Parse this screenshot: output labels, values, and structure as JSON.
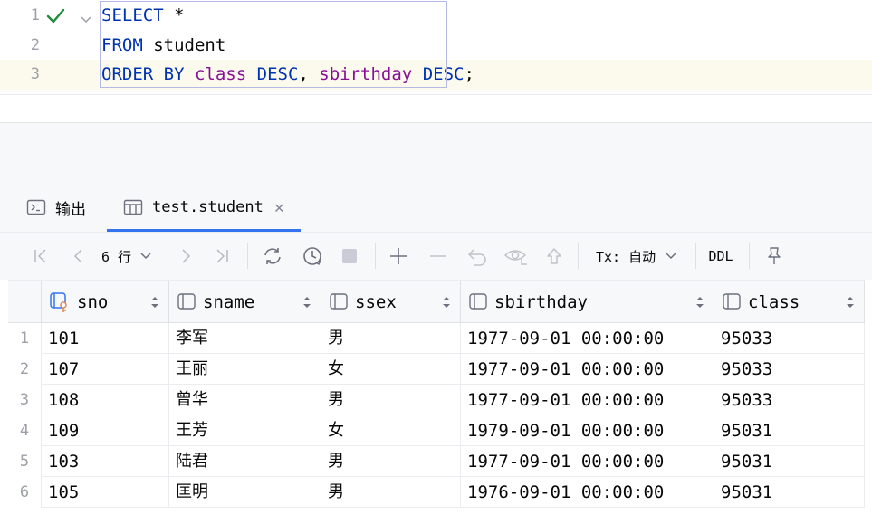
{
  "editor": {
    "lines": [
      {
        "number": "1",
        "tokens": [
          {
            "t": "SELECT",
            "c": "kw"
          },
          {
            "t": " *",
            "c": ""
          }
        ]
      },
      {
        "number": "2",
        "tokens": [
          {
            "t": "FROM",
            "c": "kw"
          },
          {
            "t": " student",
            "c": ""
          }
        ]
      },
      {
        "number": "3",
        "tokens": [
          {
            "t": "ORDER BY",
            "c": "kw"
          },
          {
            "t": " ",
            "c": ""
          },
          {
            "t": "class",
            "c": "fld"
          },
          {
            "t": " ",
            "c": ""
          },
          {
            "t": "DESC",
            "c": "kw"
          },
          {
            "t": ", ",
            "c": ""
          },
          {
            "t": "sbirthday",
            "c": "fld"
          },
          {
            "t": " ",
            "c": ""
          },
          {
            "t": "DESC",
            "c": "kw"
          },
          {
            "t": ";",
            "c": ""
          }
        ]
      }
    ],
    "status_icon": "checkmark-icon",
    "fold_icon": "chevron-down-icon"
  },
  "tabs": {
    "output_label": "输出",
    "student_label": "test.student"
  },
  "toolbar": {
    "rows_label": "6 行",
    "tx_label": "Tx: 自动",
    "ddl_label": "DDL"
  },
  "table": {
    "columns": [
      "sno",
      "sname",
      "ssex",
      "sbirthday",
      "class"
    ],
    "rows": [
      {
        "n": "1",
        "cells": [
          "101",
          "李军",
          "男",
          "1977-09-01 00:00:00",
          "95033"
        ]
      },
      {
        "n": "2",
        "cells": [
          "107",
          "王丽",
          "女",
          "1977-09-01 00:00:00",
          "95033"
        ]
      },
      {
        "n": "3",
        "cells": [
          "108",
          "曾华",
          "男",
          "1977-09-01 00:00:00",
          "95033"
        ]
      },
      {
        "n": "4",
        "cells": [
          "109",
          "王芳",
          "女",
          "1979-09-01 00:00:00",
          "95031"
        ]
      },
      {
        "n": "5",
        "cells": [
          "103",
          "陆君",
          "男",
          "1977-09-01 00:00:00",
          "95031"
        ]
      },
      {
        "n": "6",
        "cells": [
          "105",
          "匡明",
          "男",
          "1976-09-01 00:00:00",
          "95031"
        ]
      }
    ]
  },
  "colors": {
    "keyword": "#0033b3",
    "field": "#871094",
    "accent": "#3574f0",
    "success": "#208a3c"
  }
}
